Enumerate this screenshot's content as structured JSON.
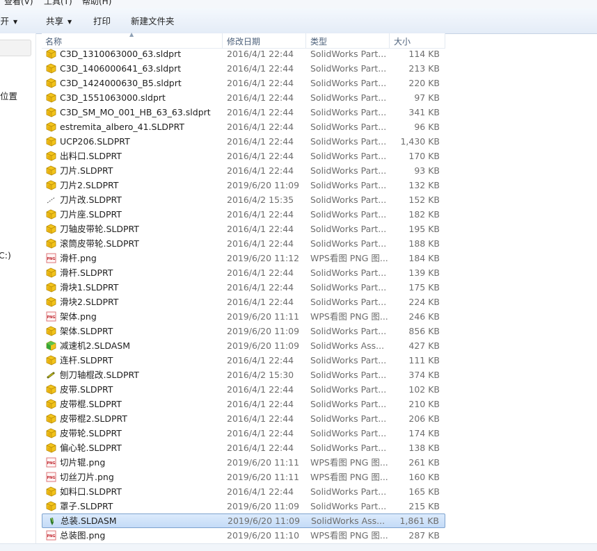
{
  "menubar": {
    "view": "查看(V)",
    "tools": "工具(T)",
    "help": "帮助(H)"
  },
  "toolbar": {
    "open": "打开",
    "share": "共享",
    "print": "打印",
    "new_folder": "新建文件夹"
  },
  "navpane": {
    "location": "位置",
    "drive": "C:)"
  },
  "columns": {
    "name": "名称",
    "date": "修改日期",
    "type": "类型",
    "size": "大小"
  },
  "files": [
    {
      "name": "C3D_1310063000_63.sldprt",
      "date": "2016/4/1 22:44",
      "type": "SolidWorks Part...",
      "size": "114 KB",
      "icon": "solidworks-part-icon"
    },
    {
      "name": "C3D_1406000641_63.sldprt",
      "date": "2016/4/1 22:44",
      "type": "SolidWorks Part...",
      "size": "213 KB",
      "icon": "solidworks-part-icon"
    },
    {
      "name": "C3D_1424000630_B5.sldprt",
      "date": "2016/4/1 22:44",
      "type": "SolidWorks Part...",
      "size": "220 KB",
      "icon": "solidworks-part-icon"
    },
    {
      "name": "C3D_1551063000.sldprt",
      "date": "2016/4/1 22:44",
      "type": "SolidWorks Part...",
      "size": "97 KB",
      "icon": "solidworks-part-icon"
    },
    {
      "name": "C3D_SM_MO_001_HB_63_63.sldprt",
      "date": "2016/4/1 22:44",
      "type": "SolidWorks Part...",
      "size": "341 KB",
      "icon": "solidworks-part-icon"
    },
    {
      "name": "estremita_albero_41.SLDPRT",
      "date": "2016/4/1 22:44",
      "type": "SolidWorks Part...",
      "size": "96 KB",
      "icon": "solidworks-part-icon"
    },
    {
      "name": "UCP206.SLDPRT",
      "date": "2016/4/1 22:44",
      "type": "SolidWorks Part...",
      "size": "1,430 KB",
      "icon": "solidworks-part-icon"
    },
    {
      "name": "出料口.SLDPRT",
      "date": "2016/4/1 22:44",
      "type": "SolidWorks Part...",
      "size": "170 KB",
      "icon": "solidworks-part-icon"
    },
    {
      "name": "刀片.SLDPRT",
      "date": "2016/4/1 22:44",
      "type": "SolidWorks Part...",
      "size": "93 KB",
      "icon": "solidworks-part-icon"
    },
    {
      "name": "刀片2.SLDPRT",
      "date": "2019/6/20 11:09",
      "type": "SolidWorks Part...",
      "size": "132 KB",
      "icon": "solidworks-part-icon"
    },
    {
      "name": "刀片改.SLDPRT",
      "date": "2016/4/2 15:35",
      "type": "SolidWorks Part...",
      "size": "152 KB",
      "icon": "sketch-thumbnail-icon"
    },
    {
      "name": "刀片座.SLDPRT",
      "date": "2016/4/1 22:44",
      "type": "SolidWorks Part...",
      "size": "182 KB",
      "icon": "solidworks-part-icon"
    },
    {
      "name": "刀轴皮带轮.SLDPRT",
      "date": "2016/4/1 22:44",
      "type": "SolidWorks Part...",
      "size": "195 KB",
      "icon": "solidworks-part-icon"
    },
    {
      "name": "滚筒皮带轮.SLDPRT",
      "date": "2016/4/1 22:44",
      "type": "SolidWorks Part...",
      "size": "188 KB",
      "icon": "solidworks-part-icon"
    },
    {
      "name": "滑杆.png",
      "date": "2019/6/20 11:12",
      "type": "WPS看图 PNG 图...",
      "size": "184 KB",
      "icon": "png-file-icon"
    },
    {
      "name": "滑杆.SLDPRT",
      "date": "2016/4/1 22:44",
      "type": "SolidWorks Part...",
      "size": "139 KB",
      "icon": "solidworks-part-icon"
    },
    {
      "name": "滑块1.SLDPRT",
      "date": "2016/4/1 22:44",
      "type": "SolidWorks Part...",
      "size": "175 KB",
      "icon": "solidworks-part-icon"
    },
    {
      "name": "滑块2.SLDPRT",
      "date": "2016/4/1 22:44",
      "type": "SolidWorks Part...",
      "size": "224 KB",
      "icon": "solidworks-part-icon"
    },
    {
      "name": "架体.png",
      "date": "2019/6/20 11:11",
      "type": "WPS看图 PNG 图...",
      "size": "246 KB",
      "icon": "png-file-icon"
    },
    {
      "name": "架体.SLDPRT",
      "date": "2019/6/20 11:09",
      "type": "SolidWorks Part...",
      "size": "856 KB",
      "icon": "solidworks-part-icon"
    },
    {
      "name": "减速机2.SLDASM",
      "date": "2019/6/20 11:09",
      "type": "SolidWorks Ass...",
      "size": "427 KB",
      "icon": "solidworks-assembly-icon"
    },
    {
      "name": "连杆.SLDPRT",
      "date": "2016/4/1 22:44",
      "type": "SolidWorks Part...",
      "size": "111 KB",
      "icon": "solidworks-part-icon"
    },
    {
      "name": "刨刀轴棍改.SLDPRT",
      "date": "2016/4/2 15:30",
      "type": "SolidWorks Part...",
      "size": "374 KB",
      "icon": "shaft-thumbnail-icon"
    },
    {
      "name": "皮带.SLDPRT",
      "date": "2016/4/1 22:44",
      "type": "SolidWorks Part...",
      "size": "102 KB",
      "icon": "solidworks-part-icon"
    },
    {
      "name": "皮带棍.SLDPRT",
      "date": "2016/4/1 22:44",
      "type": "SolidWorks Part...",
      "size": "210 KB",
      "icon": "solidworks-part-icon"
    },
    {
      "name": "皮带棍2.SLDPRT",
      "date": "2016/4/1 22:44",
      "type": "SolidWorks Part...",
      "size": "206 KB",
      "icon": "solidworks-part-icon"
    },
    {
      "name": "皮带轮.SLDPRT",
      "date": "2016/4/1 22:44",
      "type": "SolidWorks Part...",
      "size": "174 KB",
      "icon": "solidworks-part-icon"
    },
    {
      "name": "偏心轮.SLDPRT",
      "date": "2016/4/1 22:44",
      "type": "SolidWorks Part...",
      "size": "138 KB",
      "icon": "solidworks-part-icon"
    },
    {
      "name": "切片辊.png",
      "date": "2019/6/20 11:11",
      "type": "WPS看图 PNG 图...",
      "size": "261 KB",
      "icon": "png-file-icon"
    },
    {
      "name": "切丝刀片.png",
      "date": "2019/6/20 11:11",
      "type": "WPS看图 PNG 图...",
      "size": "160 KB",
      "icon": "png-file-icon"
    },
    {
      "name": "如料口.SLDPRT",
      "date": "2016/4/1 22:44",
      "type": "SolidWorks Part...",
      "size": "165 KB",
      "icon": "solidworks-part-icon"
    },
    {
      "name": "罩子.SLDPRT",
      "date": "2019/6/20 11:09",
      "type": "SolidWorks Part...",
      "size": "215 KB",
      "icon": "solidworks-part-icon"
    },
    {
      "name": "总装.SLDASM",
      "date": "2019/6/20 11:09",
      "type": "SolidWorks Ass...",
      "size": "1,861 KB",
      "icon": "assembly-thumbnail-icon",
      "selected": true
    },
    {
      "name": "总装图.png",
      "date": "2019/6/20 11:10",
      "type": "WPS看图 PNG 图...",
      "size": "287 KB",
      "icon": "png-file-icon"
    }
  ]
}
